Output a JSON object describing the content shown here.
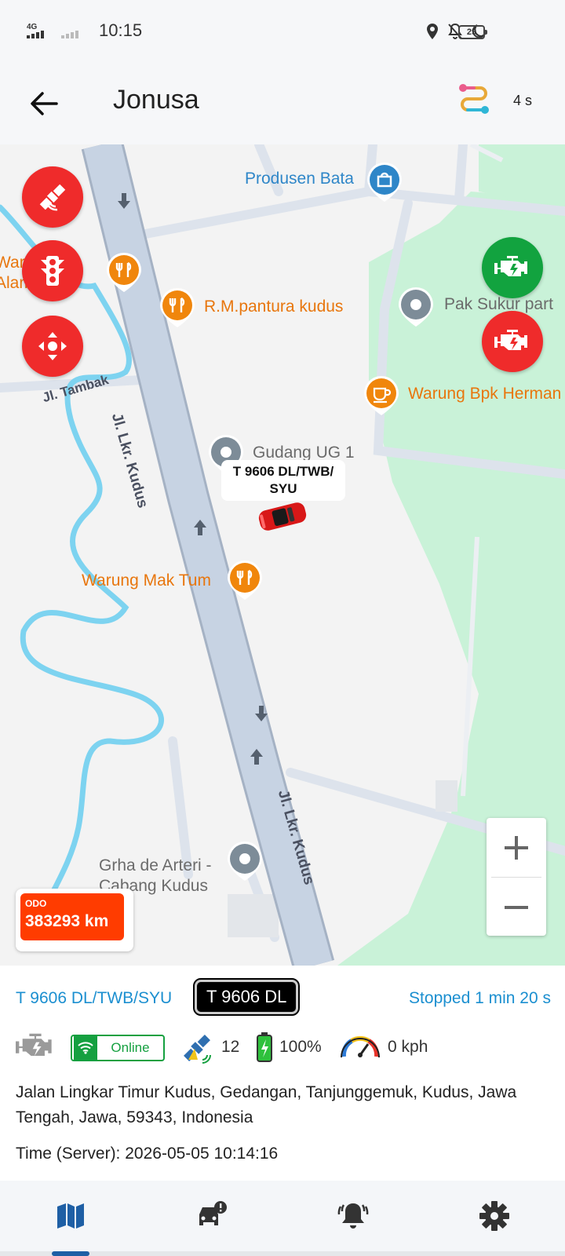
{
  "status_bar": {
    "network": "4G",
    "time": "10:15",
    "battery": "29",
    "icons": [
      "location-icon",
      "bell-off-icon",
      "moon-icon"
    ]
  },
  "header": {
    "title": "Jonusa",
    "refresh_label": "4 s"
  },
  "map": {
    "pois": [
      {
        "name": "Produsen Bata",
        "icon": "shopping-bag-icon"
      },
      {
        "name": "R.M.pantura kudus",
        "icon": "restaurant-icon"
      },
      {
        "name": "Pak Sukur part",
        "icon": "place-icon"
      },
      {
        "name": "Warung Bpk Herman",
        "icon": "cafe-icon"
      },
      {
        "name": "Gudang UG 1",
        "icon": "place-icon"
      },
      {
        "name": "Warung Mak Tum",
        "icon": "restaurant-icon"
      },
      {
        "name": "Grha de Arteri -\nCabang Kudus",
        "icon": "place-icon"
      },
      {
        "name": "Warung Alam Indah",
        "icon": "restaurant-icon"
      }
    ],
    "streets": [
      "Jl. Lkr. Kudus",
      "Jl. Lkr. Kudus",
      "Jl. Tambak"
    ],
    "vehicle_label": "T 9606 DL/TWB/\nSYU",
    "zoom_in": "+",
    "zoom_out": "−",
    "odo": {
      "label": "ODO",
      "value": "383293 km"
    },
    "colors": {
      "road": "#c7d3e3",
      "water": "#7dd3f0",
      "park": "#c9f2d8",
      "fab_red": "#ef2b2b",
      "fab_green": "#12a33f"
    }
  },
  "vehicle": {
    "name": "T 9606 DL/TWB/SYU",
    "plate": "T 9606 DL",
    "status": "Stopped 1 min 20 s",
    "online": "Online",
    "satellites": "12",
    "battery": "100%",
    "speed": "0 kph",
    "address": "Jalan Lingkar Timur Kudus, Gedangan, Tanjunggemuk, Kudus, Jawa Tengah, Jawa, 59343, Indonesia",
    "time": "Time (Server): 2026-05-05 10:14:16"
  },
  "bottom_nav": [
    "map-icon",
    "car-alert-icon",
    "alarm-icon",
    "settings-icon"
  ]
}
